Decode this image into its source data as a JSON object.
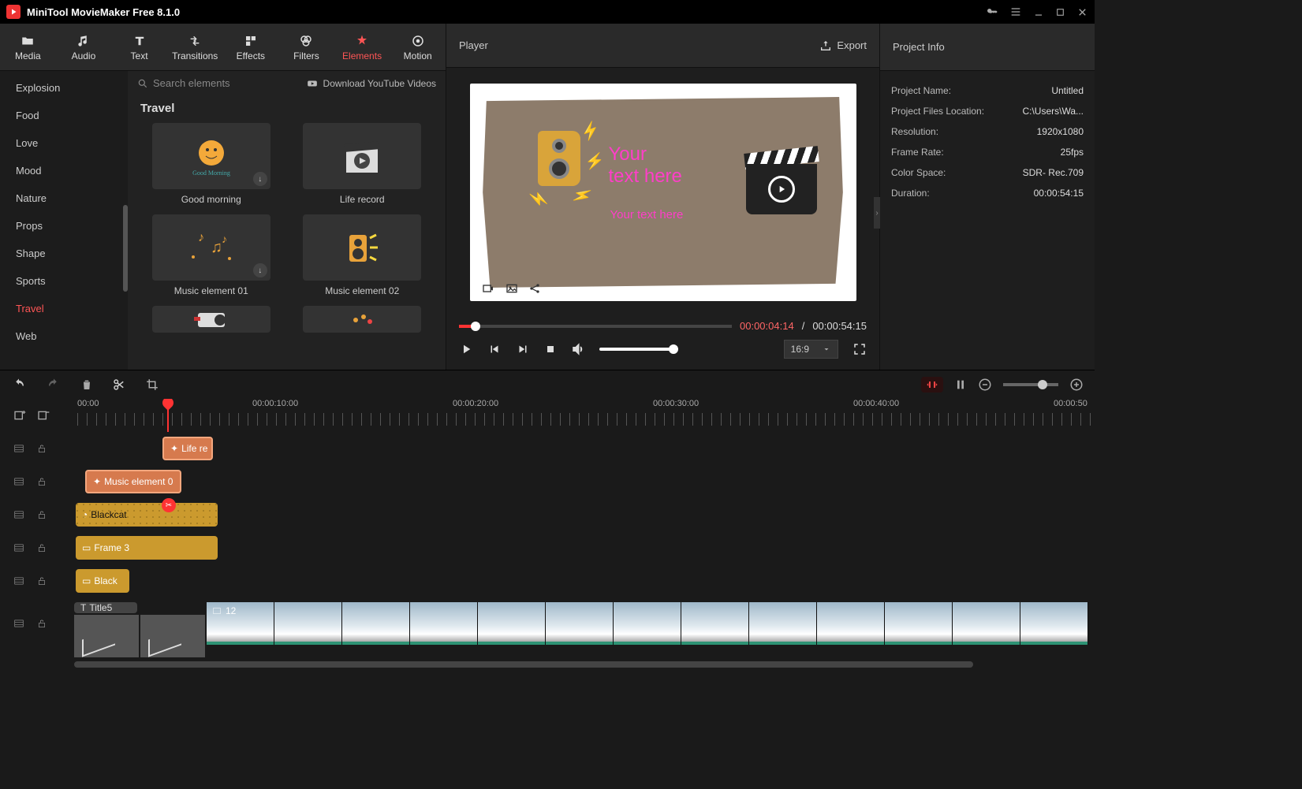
{
  "app": {
    "title": "MiniTool MovieMaker Free 8.1.0"
  },
  "tabs": [
    {
      "label": "Media"
    },
    {
      "label": "Audio"
    },
    {
      "label": "Text"
    },
    {
      "label": "Transitions"
    },
    {
      "label": "Effects"
    },
    {
      "label": "Filters"
    },
    {
      "label": "Elements"
    },
    {
      "label": "Motion"
    }
  ],
  "categories": [
    {
      "label": "Explosion"
    },
    {
      "label": "Food"
    },
    {
      "label": "Love"
    },
    {
      "label": "Mood"
    },
    {
      "label": "Nature"
    },
    {
      "label": "Props"
    },
    {
      "label": "Shape"
    },
    {
      "label": "Sports"
    },
    {
      "label": "Travel"
    },
    {
      "label": "Web"
    }
  ],
  "search": {
    "placeholder": "Search elements"
  },
  "download_link": "Download YouTube Videos",
  "section_title": "Travel",
  "cards": [
    {
      "label": "Good morning"
    },
    {
      "label": "Life record"
    },
    {
      "label": "Music element 01"
    },
    {
      "label": "Music element 02"
    }
  ],
  "player": {
    "title": "Player",
    "export": "Export",
    "text1": "Your\ntext here",
    "text2": "Your text here",
    "current": "00:00:04:14",
    "sep": " / ",
    "total": "00:00:54:15",
    "aspect": "16:9"
  },
  "info": {
    "title": "Project Info",
    "rows": [
      {
        "label": "Project Name:",
        "value": "Untitled"
      },
      {
        "label": "Project Files Location:",
        "value": "C:\\Users\\Wa..."
      },
      {
        "label": "Resolution:",
        "value": "1920x1080"
      },
      {
        "label": "Frame Rate:",
        "value": "25fps"
      },
      {
        "label": "Color Space:",
        "value": "SDR- Rec.709"
      },
      {
        "label": "Duration:",
        "value": "00:00:54:15"
      }
    ]
  },
  "ruler": [
    "00:00",
    "00:00:10:00",
    "00:00:20:00",
    "00:00:30:00",
    "00:00:40:00",
    "00:00:50"
  ],
  "clips": {
    "r1": "Life re",
    "r2": "Music element 0",
    "r3": "Blackcat",
    "r4": "Frame 3",
    "r5": "Black"
  },
  "title_clip": "Title5",
  "frame_count": "12"
}
